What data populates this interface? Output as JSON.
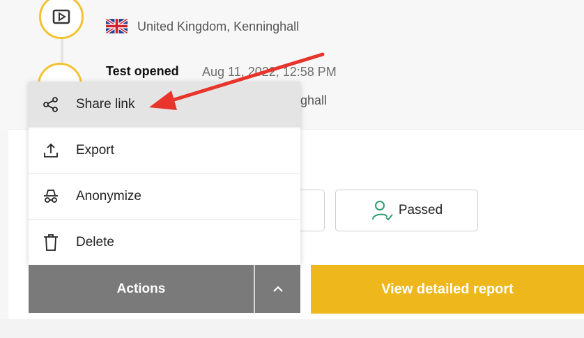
{
  "timeline": {
    "event1": {
      "location": "United Kingdom, Kenninghall"
    },
    "event2": {
      "title": "Test opened",
      "time": "Aug 11, 2022, 12:58 PM",
      "location_visible": "ghall"
    }
  },
  "status_buttons": {
    "passed_label": "Passed"
  },
  "menu": {
    "items": [
      {
        "label": "Share link",
        "icon": "share-icon"
      },
      {
        "label": "Export",
        "icon": "export-icon"
      },
      {
        "label": "Anonymize",
        "icon": "incognito-icon"
      },
      {
        "label": "Delete",
        "icon": "trash-icon"
      }
    ]
  },
  "actions": {
    "label": "Actions",
    "toggle_icon": "chevron-up-icon"
  },
  "report_button": {
    "label": "View detailed report"
  },
  "colors": {
    "accent": "#eeb71c",
    "annotation_arrow": "#e8352c",
    "actions_bg": "#7a7a7a",
    "passed_icon": "#2a9d72"
  }
}
